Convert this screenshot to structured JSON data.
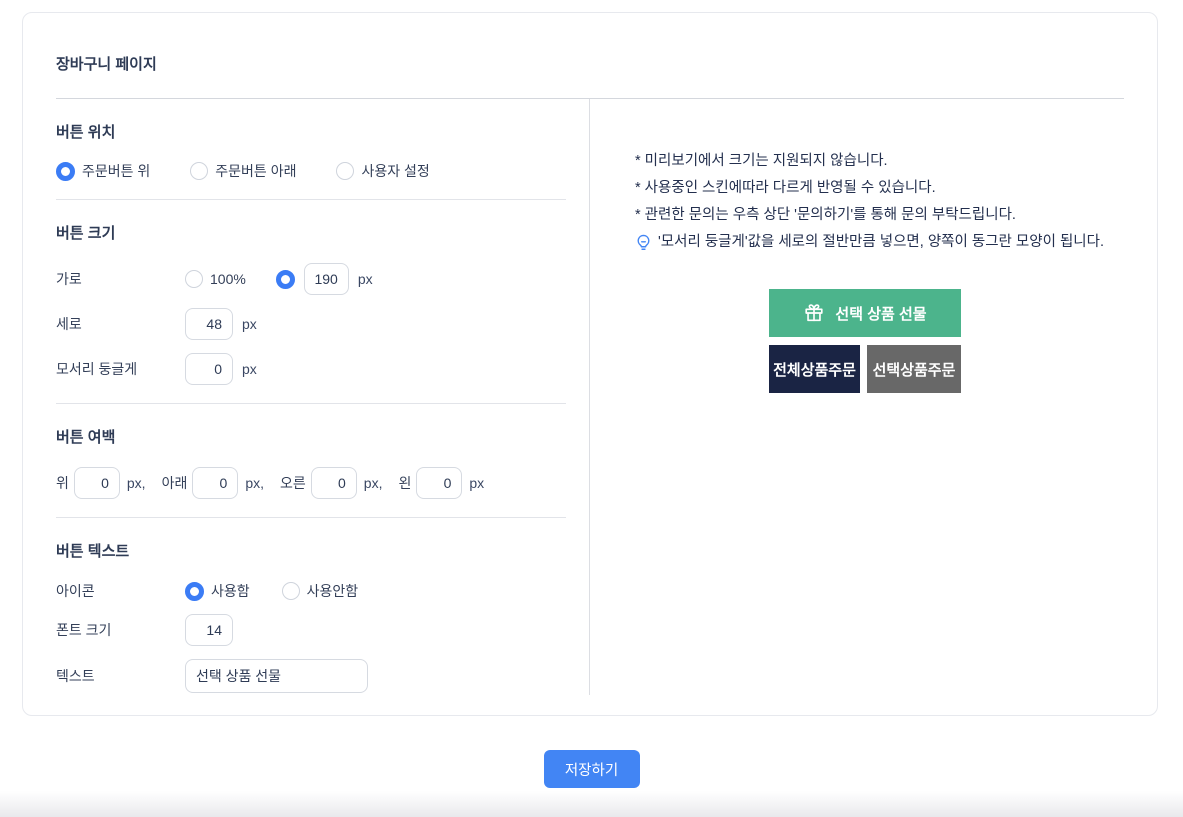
{
  "colors": {
    "accent_blue": "#3b7cf5",
    "save_blue": "#4285f4",
    "preview_green": "#4cb48c",
    "preview_navy": "#1a2444",
    "preview_gray": "#686868"
  },
  "page": {
    "title": "장바구니 페이지"
  },
  "position": {
    "heading": "버튼 위치",
    "options": [
      {
        "label": "주문버튼 위",
        "selected": true
      },
      {
        "label": "주문버튼 아래",
        "selected": false
      },
      {
        "label": "사용자 설정",
        "selected": false
      }
    ]
  },
  "size": {
    "heading": "버튼 크기",
    "width_label": "가로",
    "width_percent_option": "100%",
    "width_value": "190",
    "height_label": "세로",
    "height_value": "48",
    "radius_label": "모서리 둥글게",
    "radius_value": "0",
    "unit": "px"
  },
  "margin": {
    "heading": "버튼 여백",
    "top_label": "위",
    "top_value": "0",
    "bottom_label": "아래",
    "bottom_value": "0",
    "right_label": "오른",
    "right_value": "0",
    "left_label": "왼",
    "left_value": "0",
    "unit_comma": "px,",
    "unit": "px"
  },
  "text_section": {
    "heading": "버튼 텍스트",
    "icon_label": "아이콘",
    "icon_on": "사용함",
    "icon_off": "사용안함",
    "font_size_label": "폰트 크기",
    "font_size_value": "14",
    "text_label": "텍스트",
    "text_value": "선택 상품 선물"
  },
  "preview": {
    "notes": [
      "* 미리보기에서 크기는 지원되지 않습니다.",
      "* 사용중인 스킨에따라 다르게 반영될 수 있습니다.",
      "* 관련한 문의는 우측 상단 '문의하기'를 통해 문의 부탁드립니다."
    ],
    "tip": "'모서리 둥글게'값을 세로의 절반만큼 넣으면, 양쪽이 동그란 모양이 됩니다.",
    "gift_button": "선택 상품 선물",
    "order_all_button": "전체상품주문",
    "order_selected_button": "선택상품주문"
  },
  "footer": {
    "save_label": "저장하기"
  }
}
